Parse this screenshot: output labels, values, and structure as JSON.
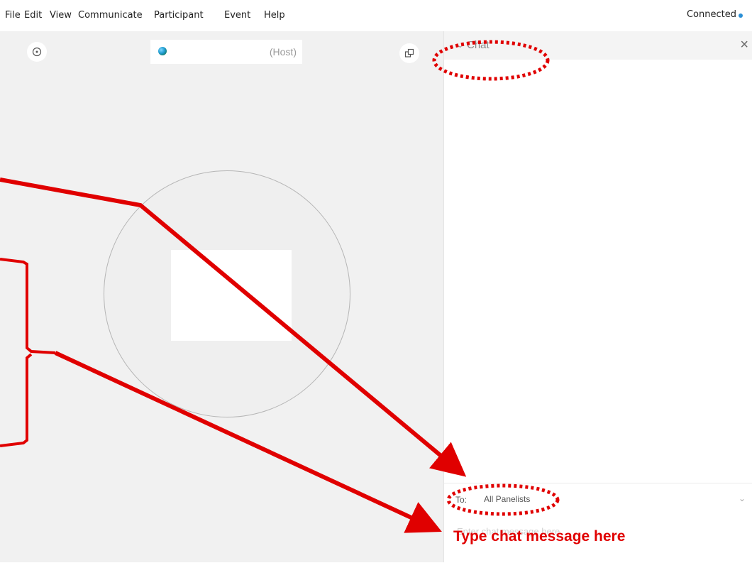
{
  "menu": {
    "items": [
      "File",
      "Edit",
      "View",
      "Communicate",
      "Participant",
      "Event",
      "Help"
    ],
    "status": "Connected",
    "status_color": "#2a8fd6"
  },
  "stage": {
    "host_label": "(Host)",
    "left_icon": "info-icon",
    "right_icon": "popout-icon"
  },
  "chat": {
    "title": "Chat",
    "close_symbol": "×",
    "collapse_symbol": "⌄",
    "to_label": "To:",
    "recipient": "All Panelists",
    "input_placeholder": "Enter chat message here"
  },
  "annotation": {
    "callout_text": "Type chat message here",
    "color": "#e00000"
  }
}
